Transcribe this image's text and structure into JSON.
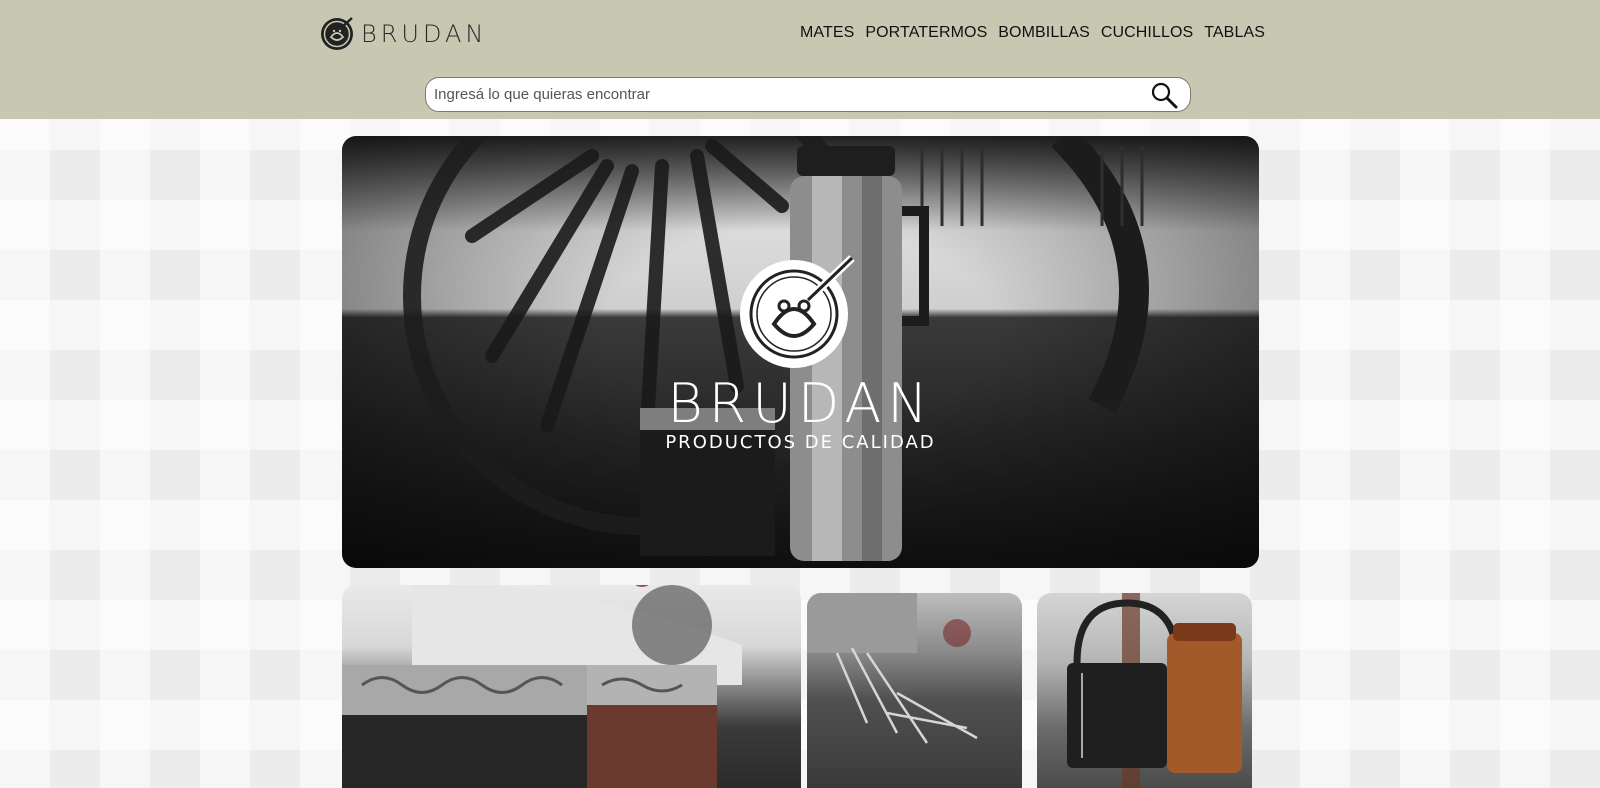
{
  "brand": {
    "name": "BRUDAN"
  },
  "nav": {
    "items": [
      "MATES",
      "PORTATERMOS",
      "BOMBILLAS",
      "CUCHILLOS",
      "TABLAS"
    ]
  },
  "search": {
    "placeholder": "Ingresá lo que quieras encontrar",
    "icon": "search-icon"
  },
  "hero": {
    "title": "BRUDAN",
    "subtitle": "PRODUCTOS DE CALIDAD"
  },
  "colors": {
    "header_bg": "#c8c8b2",
    "page_bg": "#ececec"
  }
}
